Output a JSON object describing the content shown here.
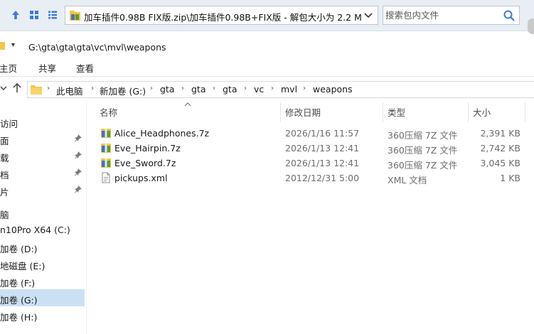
{
  "archive_bar": {
    "path_text": "加车插件0.98B FIX版.zip\\加车插件0.98B+FIX版 - 解包大小为 2.2 M",
    "search_placeholder": "搜索包内文件",
    "accent_color": "#f2b705"
  },
  "explorer": {
    "title_path": "G:\\gta\\gta\\gta\\vc\\mvl\\weapons",
    "ribbon_tabs": [
      "主页",
      "共享",
      "查看"
    ],
    "breadcrumbs": [
      "此电脑",
      "新加卷 (G:)",
      "gta",
      "gta",
      "gta",
      "vc",
      "mvl",
      "weapons"
    ]
  },
  "nav_pane": {
    "items": [
      {
        "label": "访问",
        "pinned": false
      },
      {
        "label": "面",
        "pinned": true
      },
      {
        "label": "载",
        "pinned": true
      },
      {
        "label": "档",
        "pinned": true
      },
      {
        "label": "片",
        "pinned": true
      },
      {
        "label": "脑",
        "pinned": false
      },
      {
        "label": "n10Pro X64 (C:)",
        "pinned": false
      },
      {
        "label": "加卷 (D:)",
        "pinned": false
      },
      {
        "label": "地磁盘 (E:)",
        "pinned": false
      },
      {
        "label": "加卷 (F:)",
        "pinned": false
      },
      {
        "label": "加卷 (G:)",
        "pinned": false,
        "selected": true
      },
      {
        "label": "加卷 (H:)",
        "pinned": false
      }
    ]
  },
  "file_list": {
    "columns": {
      "name": "名称",
      "date": "修改日期",
      "type": "类型",
      "size": "大小"
    },
    "rows": [
      {
        "name": "Alice_Headphones.7z",
        "date": "2026/1/16 11:57",
        "type": "360压缩 7Z 文件",
        "size": "2,391 KB",
        "icon": "archive-icon"
      },
      {
        "name": "Eve_Hairpin.7z",
        "date": "2026/1/13 12:41",
        "type": "360压缩 7Z 文件",
        "size": "2,742 KB",
        "icon": "archive-icon"
      },
      {
        "name": "Eve_Sword.7z",
        "date": "2026/1/13 12:41",
        "type": "360压缩 7Z 文件",
        "size": "3,045 KB",
        "icon": "archive-icon"
      },
      {
        "name": "pickups.xml",
        "date": "2012/12/31 5:00",
        "type": "XML 文档",
        "size": "1 KB",
        "icon": "xml-file-icon"
      }
    ]
  }
}
